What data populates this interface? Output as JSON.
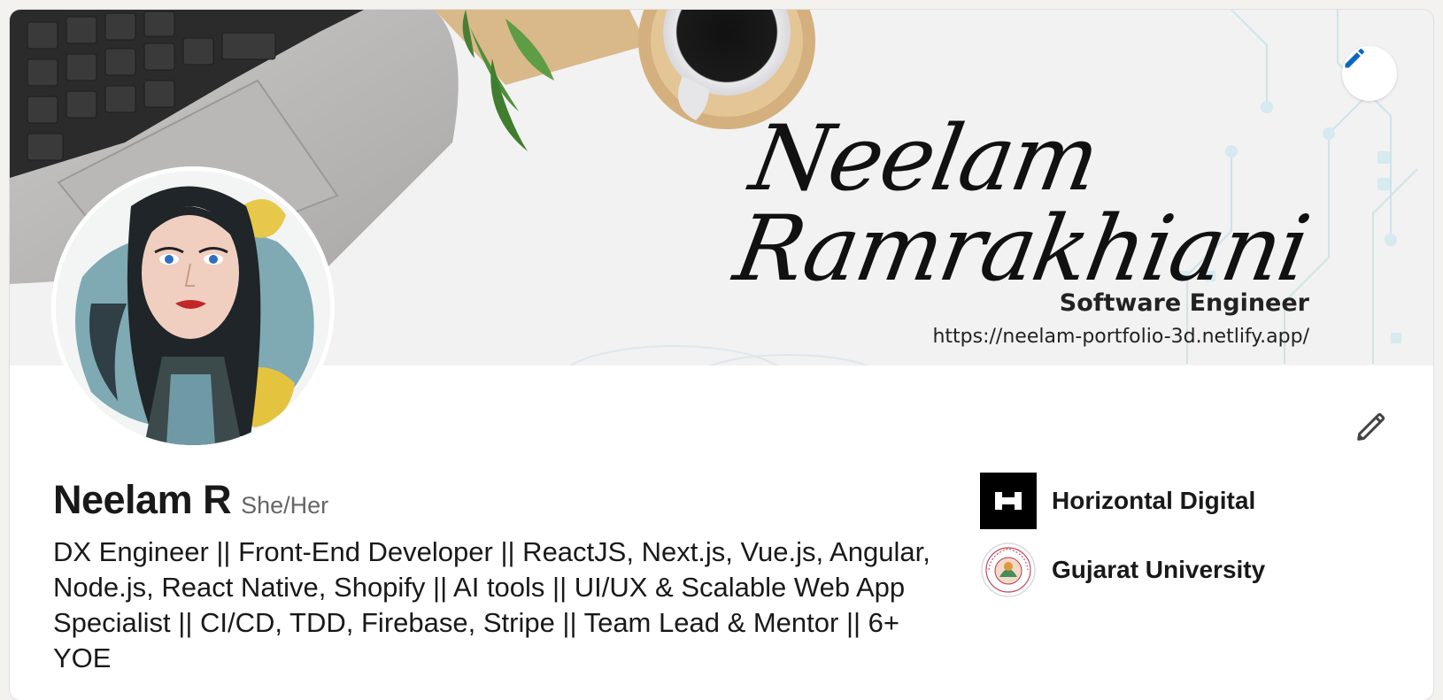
{
  "banner": {
    "signature": "Neelam Ramrakhiani",
    "role": "Software Engineer",
    "url": "https://neelam-portfolio-3d.netlify.app/",
    "edit_icon": "pencil-icon"
  },
  "profile": {
    "name": "Neelam R",
    "pronouns": "She/Her",
    "headline": "DX Engineer || Front-End Developer || ReactJS, Next.js, Vue.js, Angular, Node.js, React Native, Shopify || AI tools || UI/UX & Scalable Web App Specialist || CI/CD, TDD, Firebase, Stripe || Team Lead & Mentor || 6+ YOE",
    "edit_icon": "pencil-icon"
  },
  "organizations": [
    {
      "name": "Horizontal Digital",
      "logo": "horizontal-digital-logo"
    },
    {
      "name": "Gujarat University",
      "logo": "gujarat-university-seal"
    }
  ],
  "colors": {
    "accent": "#0a66c2",
    "page_bg": "#f4f2ee",
    "card_bg": "#ffffff",
    "text": "#191919",
    "muted": "#666666"
  }
}
